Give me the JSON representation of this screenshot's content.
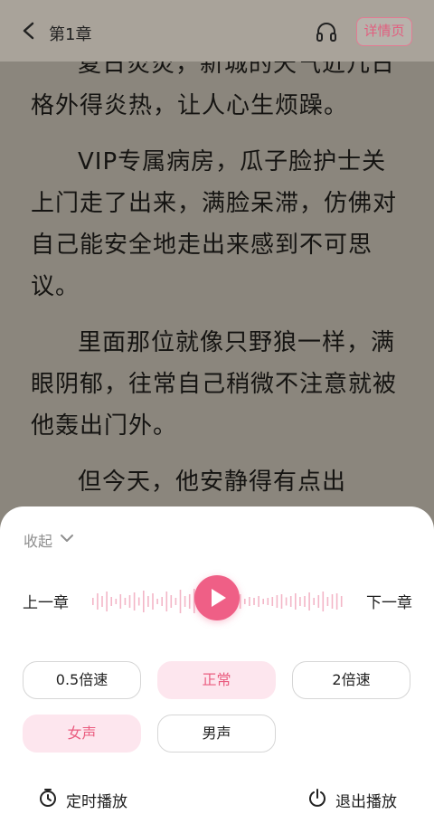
{
  "header": {
    "title": "第1章",
    "detail_label": "详情页"
  },
  "article": {
    "paragraphs": [
      "夏日炎炎，新城的天气近几日格外得炎热，让人心生烦躁。",
      "VIP专属病房，瓜子脸护士关上门走了出来，满脸呆滞，仿佛对自己能安全地走出来感到不可思议。",
      "里面那位就像只野狼一样，满眼阴郁，往常自己稍微不注意就被他轰出门外。",
      "但今天，他安静得有点出"
    ]
  },
  "player": {
    "collapse_label": "收起",
    "prev_label": "上一章",
    "next_label": "下一章",
    "speed_options": [
      "0.5倍速",
      "正常",
      "2倍速"
    ],
    "selected_speed": "正常",
    "voice_options": [
      "女声",
      "男声"
    ],
    "selected_voice": "女声",
    "timer_label": "定时播放",
    "exit_label": "退出播放"
  },
  "colors": {
    "accent": "#ef5f86",
    "active_pill_bg": "#fde6ee"
  }
}
